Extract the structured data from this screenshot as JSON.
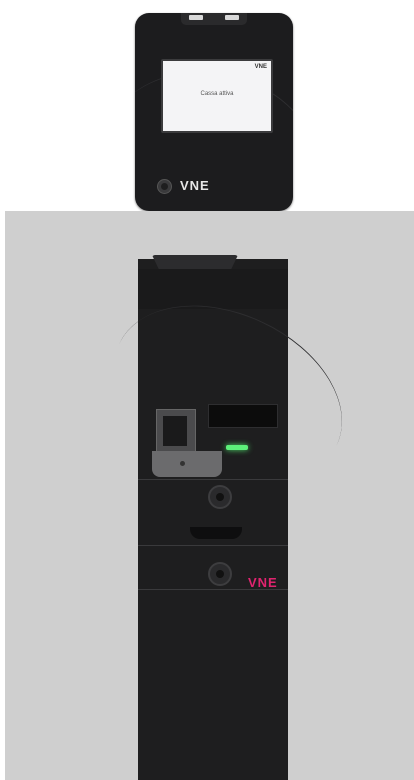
{
  "terminal": {
    "screen_message": "Cassa attiva",
    "screen_logo": "VNE",
    "brand_logo": "VNE"
  },
  "kiosk": {
    "brand_logo": "VNE",
    "status_led_color": "#5df07a",
    "brand_color": "#e0246f"
  }
}
